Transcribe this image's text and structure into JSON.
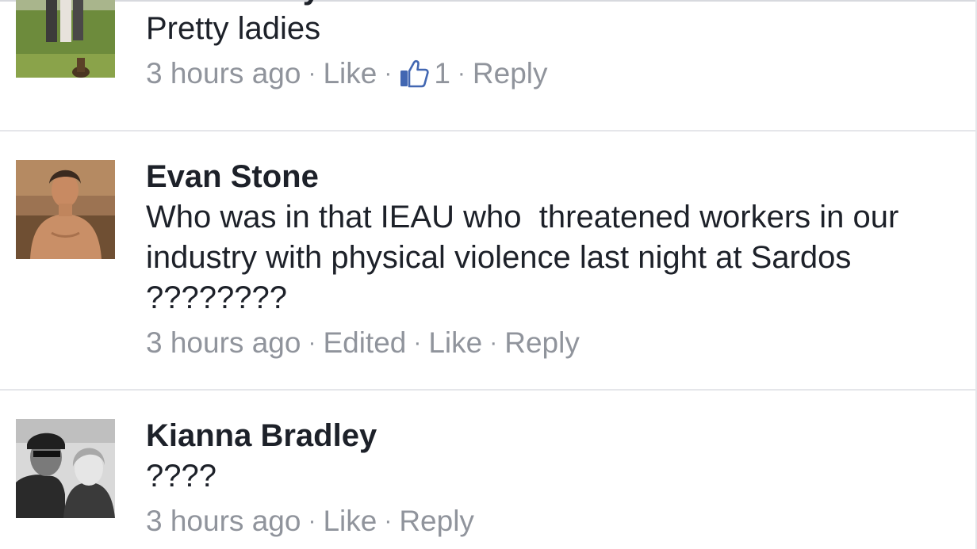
{
  "comments": [
    {
      "author": "Robbie Rayder",
      "text": "Pretty ladies",
      "time": "3 hours ago",
      "like_label": "Like",
      "like_count": "1",
      "reply_label": "Reply",
      "avatar": "photo-outdoor-group-with-dog"
    },
    {
      "author": "Evan Stone",
      "text": "Who was in that IEAU who  threatened workers in our industry with physical violence last night at Sardos ????????",
      "time": "3 hours ago",
      "edited_label": "Edited",
      "like_label": "Like",
      "reply_label": "Reply",
      "avatar": "photo-shirtless-man-desert"
    },
    {
      "author": "Kianna Bradley",
      "text": "????",
      "time": "3 hours ago",
      "like_label": "Like",
      "reply_label": "Reply",
      "avatar": "photo-bw-couple-selfie"
    }
  ],
  "separator": "·",
  "colors": {
    "text": "#1d2129",
    "meta": "#90949c",
    "like_icon": "#4267b2",
    "divider": "#e5e6ea"
  }
}
